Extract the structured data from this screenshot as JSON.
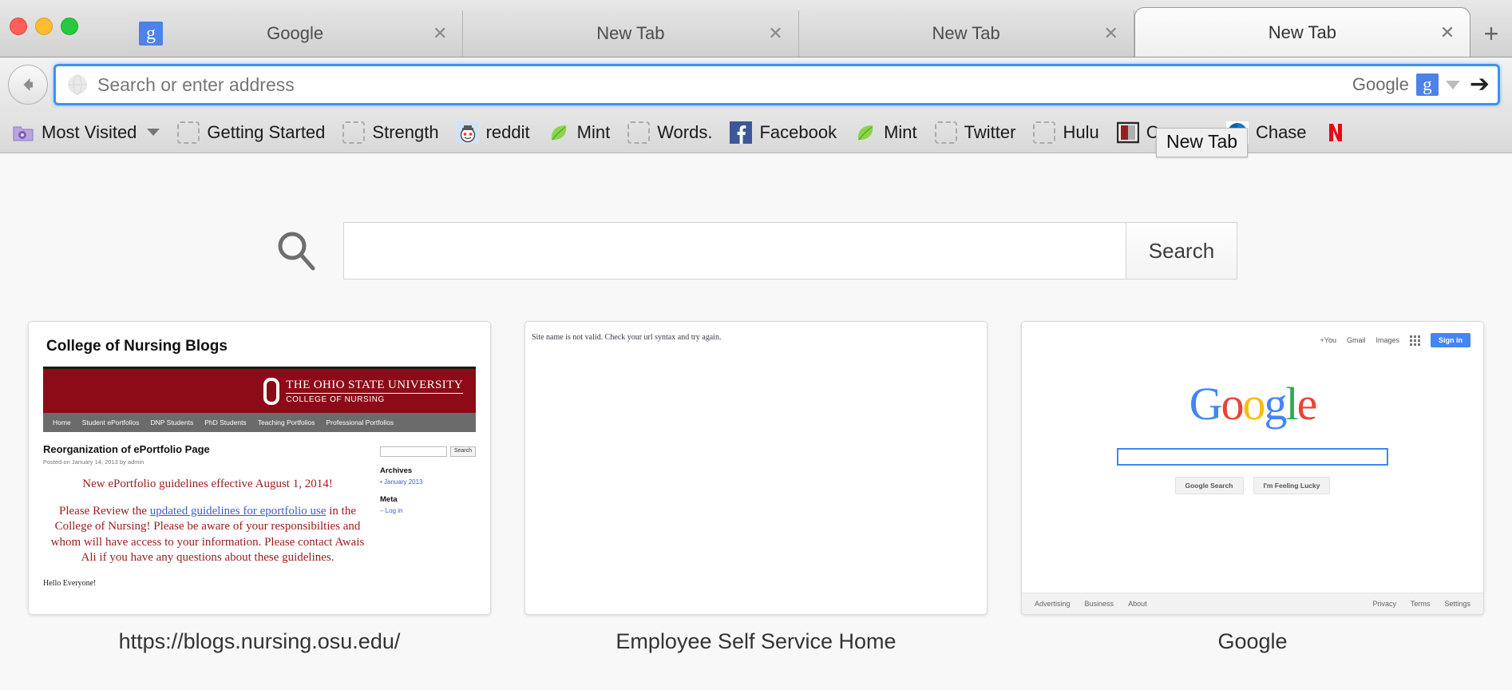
{
  "window": {
    "traffic_lights": [
      "close",
      "minimize",
      "zoom"
    ]
  },
  "tabs": [
    {
      "title": "Google",
      "favicon": "google-g-icon",
      "close": "✕",
      "active": false
    },
    {
      "title": "New Tab",
      "favicon": "none",
      "close": "✕",
      "active": false
    },
    {
      "title": "New Tab",
      "favicon": "none",
      "close": "✕",
      "active": false
    },
    {
      "title": "New Tab",
      "favicon": "none",
      "close": "✕",
      "active": true
    }
  ],
  "new_tab_button_label": "+",
  "navbar": {
    "back_label": "←",
    "url_value": "",
    "url_placeholder": "Search or enter address",
    "engine_label": "Google",
    "engine_glyph": "g",
    "go_label": "➔",
    "tooltip": "New Tab"
  },
  "bookmarks": [
    {
      "label": "Most Visited",
      "icon": "folder-gear-icon",
      "has_caret": true
    },
    {
      "label": "Getting Started",
      "icon": "placeholder-icon",
      "has_caret": false
    },
    {
      "label": "Strength",
      "icon": "placeholder-icon",
      "has_caret": false
    },
    {
      "label": "reddit",
      "icon": "reddit-alien-icon",
      "has_caret": false
    },
    {
      "label": "Mint",
      "icon": "mint-leaf-icon",
      "has_caret": false
    },
    {
      "label": "Words.",
      "icon": "placeholder-icon",
      "has_caret": false
    },
    {
      "label": "Facebook",
      "icon": "facebook-f-icon",
      "has_caret": false
    },
    {
      "label": "Mint",
      "icon": "mint-leaf-icon",
      "has_caret": false
    },
    {
      "label": "Twitter",
      "icon": "placeholder-icon",
      "has_caret": false
    },
    {
      "label": "Hulu",
      "icon": "placeholder-icon",
      "has_caret": false
    },
    {
      "label": "Carmen",
      "icon": "carmen-book-icon",
      "has_caret": false
    },
    {
      "label": "Chase",
      "icon": "chase-octagon-icon",
      "has_caret": false
    },
    {
      "label": "",
      "icon": "netflix-n-icon",
      "has_caret": false
    }
  ],
  "content": {
    "search": {
      "icon": "magnifier-icon",
      "value": "",
      "placeholder": "",
      "button_label": "Search"
    },
    "thumbnails": [
      {
        "caption": "https://blogs.nursing.osu.edu/",
        "kind": "osu-blog"
      },
      {
        "caption": "Employee Self Service Home",
        "kind": "error-page"
      },
      {
        "caption": "Google",
        "kind": "google-home"
      }
    ]
  },
  "osu_thumb": {
    "site_title": "College of Nursing Blogs",
    "brand_line1": "THE OHIO STATE UNIVERSITY",
    "brand_line2": "COLLEGE OF NURSING",
    "nav": [
      "Home",
      "Student ePortfolios",
      "DNP Students",
      "PhD Students",
      "Teaching Portfolios",
      "Professional Portfolios"
    ],
    "post_title": "Reorganization of ePortfolio Page",
    "post_meta": "Posted on January 14, 2013 by admin",
    "headline": "New ePortfolio guidelines effective August 1, 2014!",
    "body_pre": "Please Review the ",
    "body_link": "updated guidelines for eportfolio use",
    "body_post": " in the College of Nursing! Please be aware of your responsibilties and whom will have access to your information. Please contact Awais Ali if you have any questions about these guidelines.",
    "hello": "Hello Everyone!",
    "sidebar_search_btn": "Search",
    "archives_heading": "Archives",
    "archives_item": "• January 2013",
    "meta_heading": "Meta",
    "meta_item": "– Log in"
  },
  "error_thumb": {
    "message": "Site name is not valid. Check your url syntax and try again."
  },
  "google_thumb": {
    "top_links": [
      "+You",
      "Gmail",
      "Images"
    ],
    "apps_icon": "apps-grid-icon",
    "signin_label": "Sign in",
    "logo": "Google",
    "search_value": "",
    "btn_search": "Google Search",
    "btn_lucky": "I'm Feeling Lucky",
    "footer_left": [
      "Advertising",
      "Business",
      "About"
    ],
    "footer_right": [
      "Privacy",
      "Terms",
      "Settings"
    ]
  },
  "colors": {
    "focus_blue": "#3b93f7",
    "google_blue": "#4285f4",
    "osu_red": "#8c0b17",
    "netflix_red": "#e50914"
  }
}
